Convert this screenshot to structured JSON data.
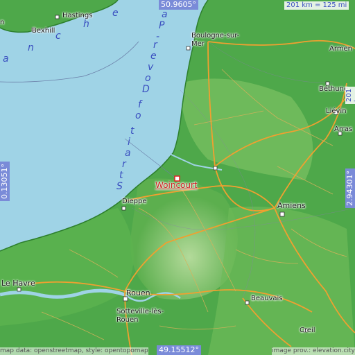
{
  "map": {
    "title": "Woincourt",
    "colors": {
      "sea": "#9fd3e6",
      "land_low": "#3e9e3e",
      "land_high": "#a9d68a",
      "coast": "#2d7f2d",
      "roads_major": "#f0a030",
      "roads_minor": "#c8a050",
      "marker": "#e02020"
    },
    "coords": {
      "top": "50.9605°",
      "bottom": "49.15512°",
      "left": "0.13051°",
      "right": "2.94301°"
    },
    "scale": {
      "km": "201 km = 125 mi",
      "km_right": "201 km = 125 mi"
    },
    "sea_labels": {
      "manche": [
        "a",
        "n",
        "c",
        "h",
        "e"
      ],
      "strait": [
        "S",
        "t",
        "r",
        "a",
        "i",
        "t",
        "o",
        "f",
        "D",
        "o",
        "v",
        "e",
        "r",
        "-",
        "P",
        "a"
      ]
    },
    "places": {
      "hastings": "Hastings",
      "bexhill": "Bexhill",
      "boulogne": "Boulogne-sur-\nMer",
      "armentieres": "Armen",
      "bethune": "Béthune",
      "lievin": "Liévin",
      "arras": "Arras",
      "woincourt": "Woincourt",
      "dieppe": "Dieppe",
      "amiens": "Amiens",
      "le_havre": "Le Havre",
      "rouen": "Rouen",
      "sotteville": "Sotteville-lès-\nRouen",
      "beauvais": "Beauvais",
      "creil": "Creil",
      "top_left_partial": "n"
    },
    "attribution": {
      "left": "map data: openstreetmap, style: opentopomap",
      "right": "image prov.: elevation.city"
    }
  }
}
